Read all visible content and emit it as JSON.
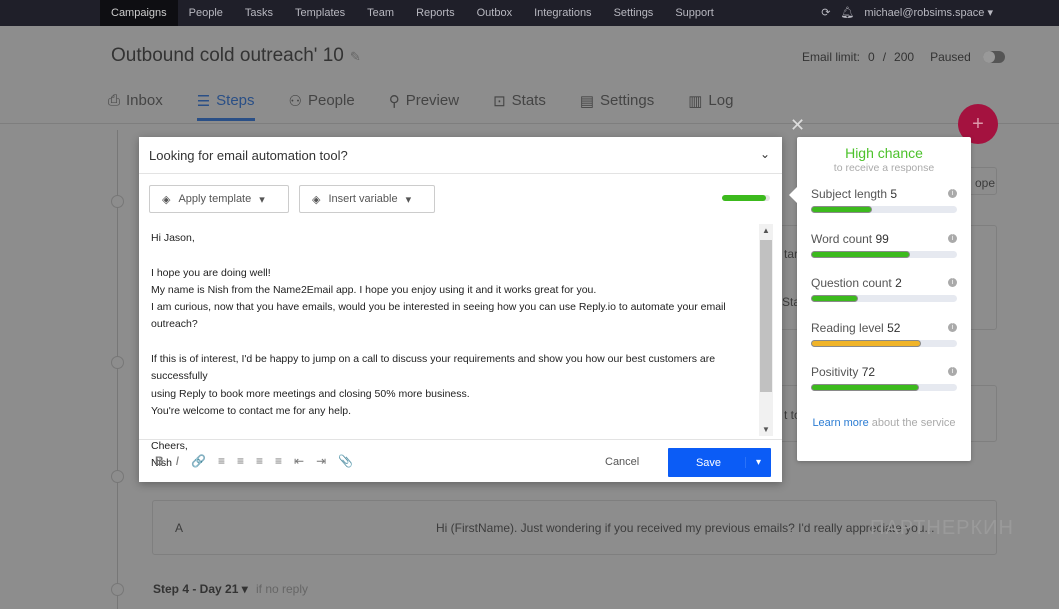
{
  "topnav": {
    "items": [
      "Campaigns",
      "People",
      "Tasks",
      "Templates",
      "Team",
      "Reports",
      "Outbox",
      "Integrations",
      "Settings",
      "Support"
    ],
    "user": "michael@robsims.space"
  },
  "header": {
    "title": "Outbound cold outreach' 10",
    "email_limit_label": "Email limit:",
    "email_limit_used": "0",
    "email_limit_sep": "/",
    "email_limit_total": "200",
    "status": "Paused"
  },
  "tabs": [
    {
      "label": "Inbox",
      "icon": "inbox-icon"
    },
    {
      "label": "Steps",
      "icon": "list-icon"
    },
    {
      "label": "People",
      "icon": "people-icon"
    },
    {
      "label": "Preview",
      "icon": "search-icon"
    },
    {
      "label": "Stats",
      "icon": "stats-icon"
    },
    {
      "label": "Settings",
      "icon": "settings-icon"
    },
    {
      "label": "Log",
      "icon": "bar-chart-icon"
    }
  ],
  "background": {
    "peek1": "tar",
    "peek2": "Star",
    "peek3": "t to",
    "peek4": "ope",
    "variant": "A",
    "preview": "Hi (FirstName).  Just wondering if you received my previous emails? I'd really appreciate you...",
    "step4": "Step 4 - Day 21",
    "step4_cond": "if no reply",
    "watermark": "ПАРТНЕРКИН"
  },
  "editor": {
    "subject": "Looking for email automation tool?",
    "apply_template": "Apply template",
    "insert_variable": "Insert variable",
    "body": [
      "Hi Jason,",
      "",
      "I hope you are doing well!",
      "My name is Nish from the Name2Email app. I hope you enjoy using it and it works great for you.",
      "I am curious, now that you have emails, would you be interested in seeing how you can use Reply.io to automate your email outreach?",
      "",
      "If this is of interest, I'd be happy to jump on a call to discuss your requirements and show you how our best customers are successfully",
      "using Reply to book more meetings and closing 50% more business.",
      "You're welcome to contact me for any help.",
      "",
      "Cheers,",
      "Nish"
    ],
    "format_tools": [
      "B",
      "I",
      "🔗",
      "≡",
      "≡",
      "≡",
      "≡",
      "⇤",
      "⇥",
      "📎"
    ],
    "cancel": "Cancel",
    "save": "Save"
  },
  "score": {
    "headline": "High chance",
    "sub": "to receive a response",
    "headline_color": "#4cc22b",
    "metrics": [
      {
        "label": "Subject length",
        "value": "5",
        "fill_pct": 42,
        "color": "#3cba1d"
      },
      {
        "label": "Word count",
        "value": "99",
        "fill_pct": 68,
        "color": "#3cba1d"
      },
      {
        "label": "Question count",
        "value": "2",
        "fill_pct": 32,
        "color": "#3cba1d"
      },
      {
        "label": "Reading level",
        "value": "52",
        "fill_pct": 75,
        "color": "#f0b429"
      },
      {
        "label": "Positivity",
        "value": "72",
        "fill_pct": 74,
        "color": "#3cba1d"
      }
    ],
    "learn_link": "Learn more",
    "learn_rest": "about the service"
  }
}
